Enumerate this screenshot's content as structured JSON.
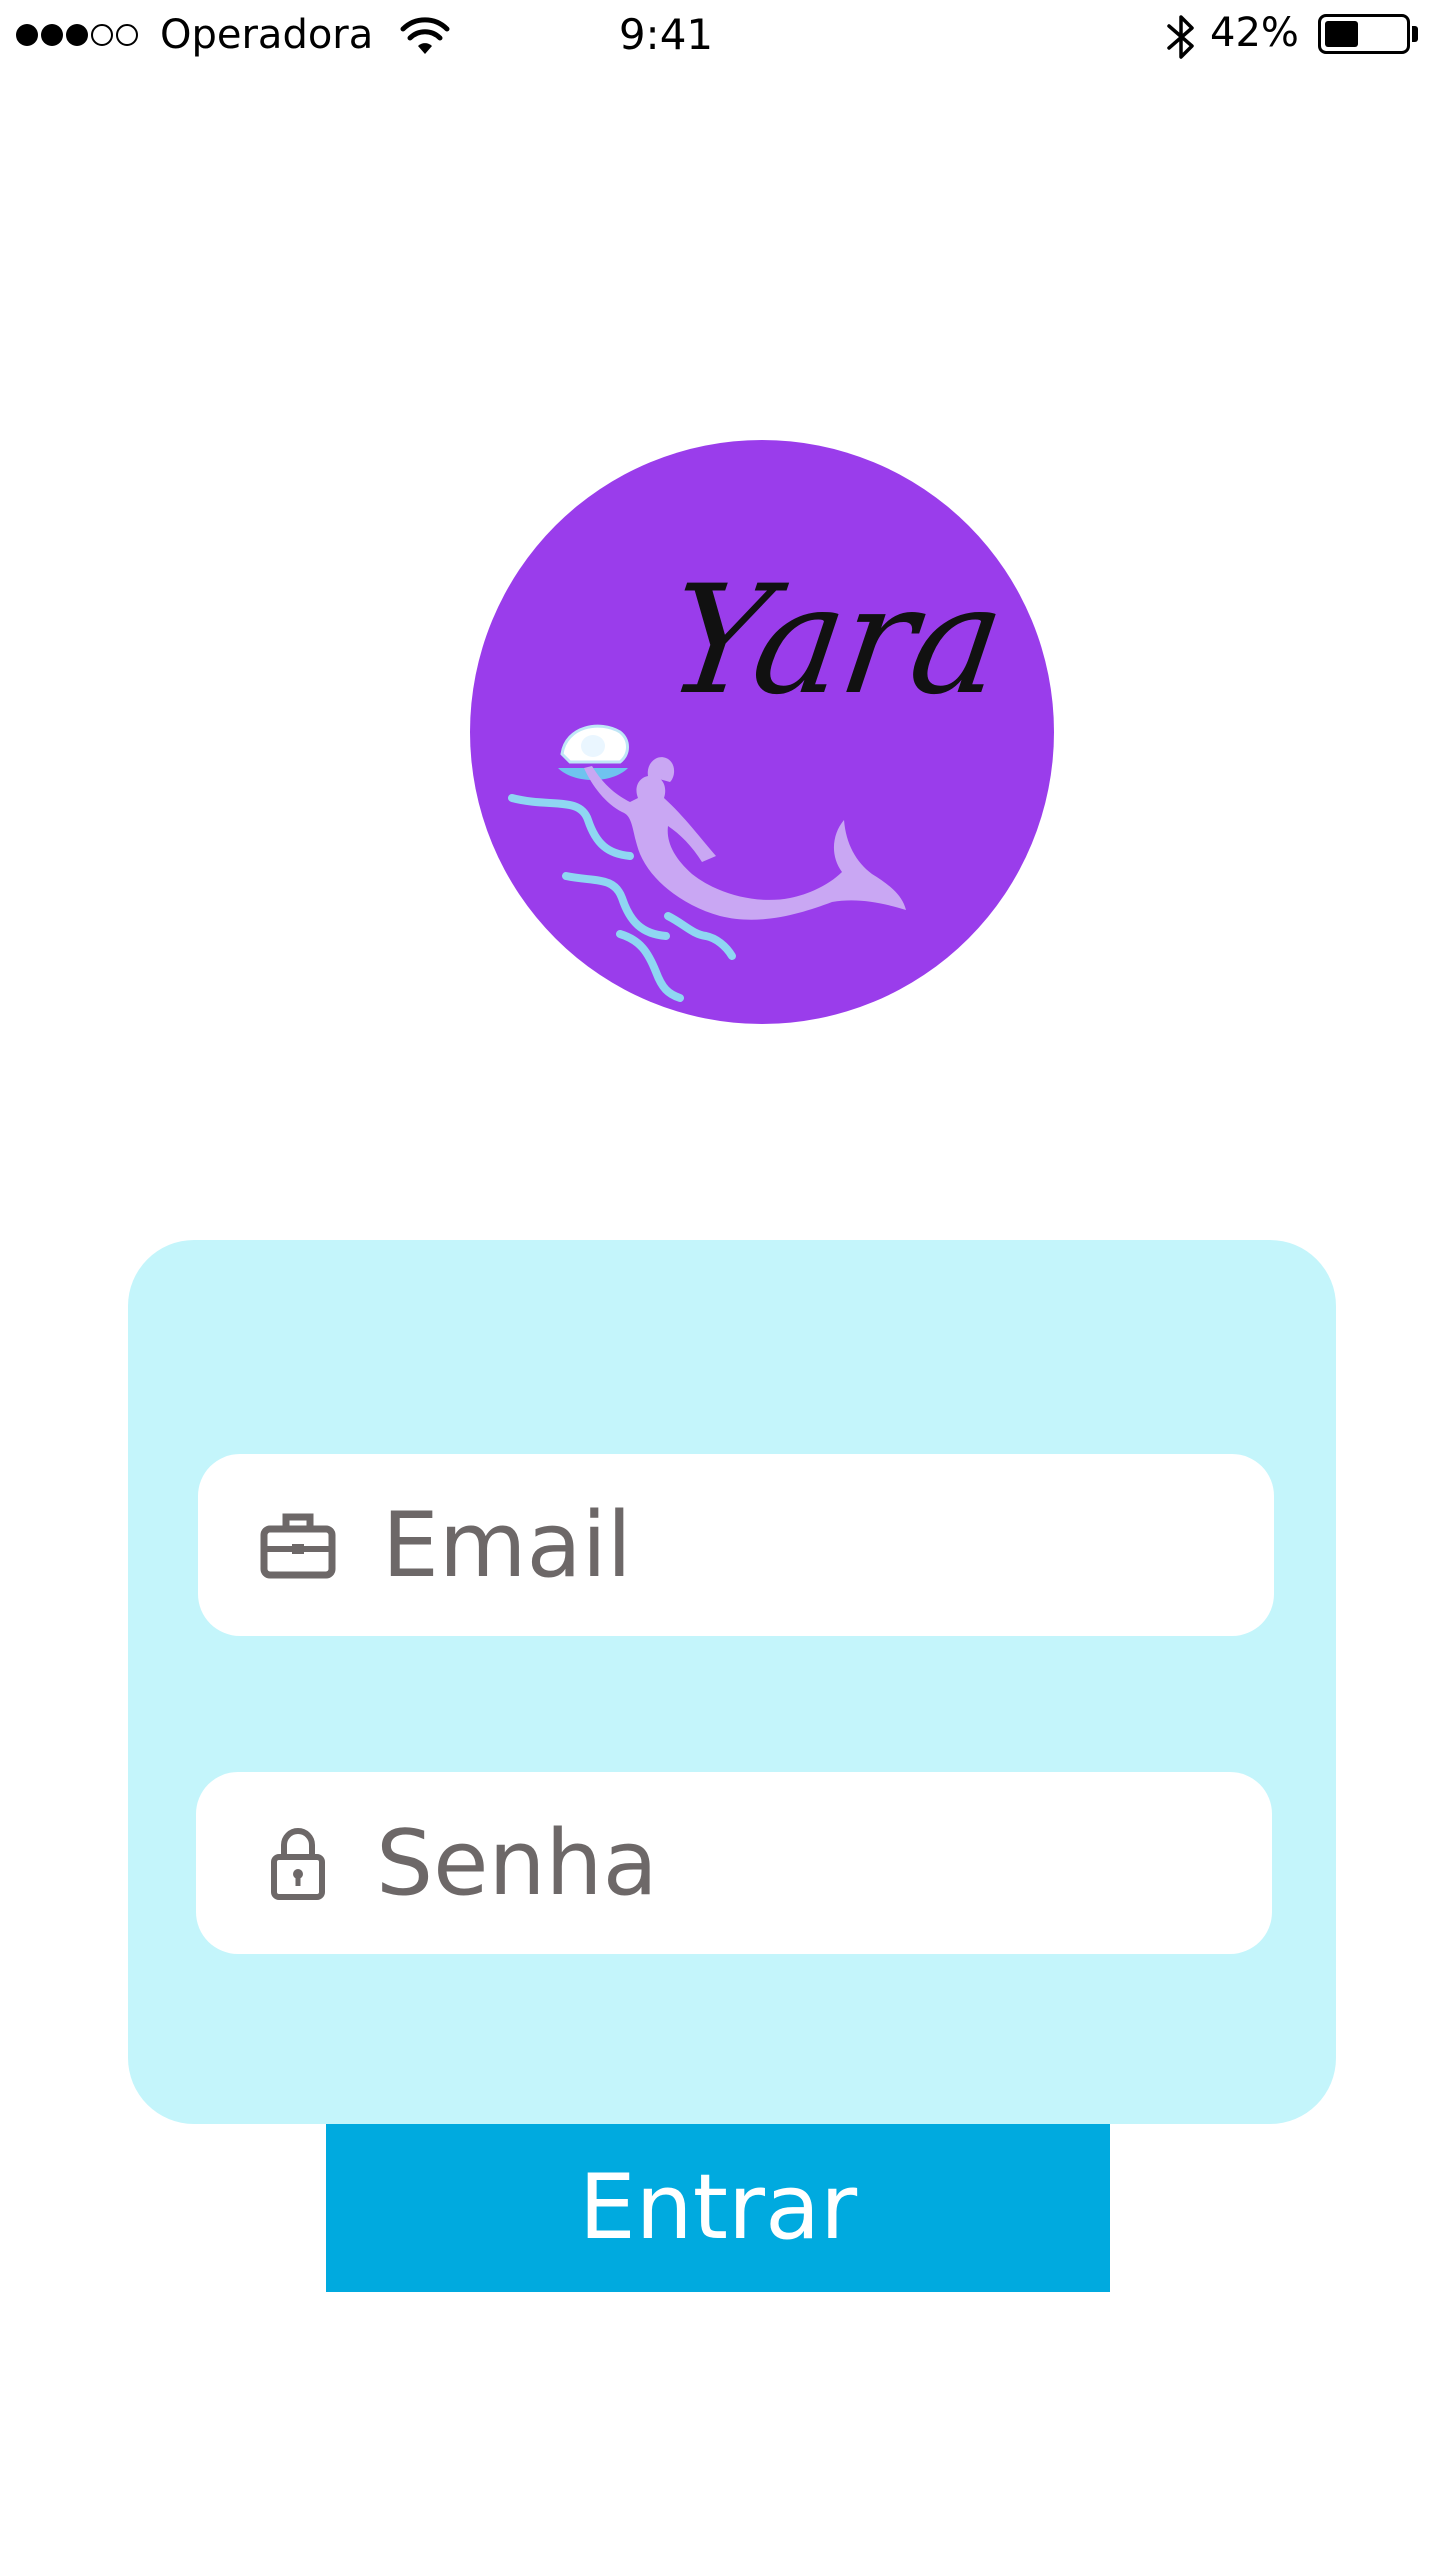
{
  "status_bar": {
    "signal_bars_total": 5,
    "signal_bars_filled": 3,
    "carrier": "Operadora",
    "time": "9:41",
    "battery_percent_label": "42%",
    "battery_level": 0.42
  },
  "logo": {
    "wordmark": "Yara",
    "circle_color": "#9a3deb",
    "mermaid_color": "#c9a7f3",
    "wave_color": "#8fd6f2"
  },
  "login": {
    "card_color": "#c4f5fb",
    "email": {
      "placeholder": "Email",
      "icon": "briefcase-icon"
    },
    "password": {
      "placeholder": "Senha",
      "icon": "lock-icon"
    },
    "submit_label": "Entrar",
    "submit_color": "#00aadf"
  }
}
